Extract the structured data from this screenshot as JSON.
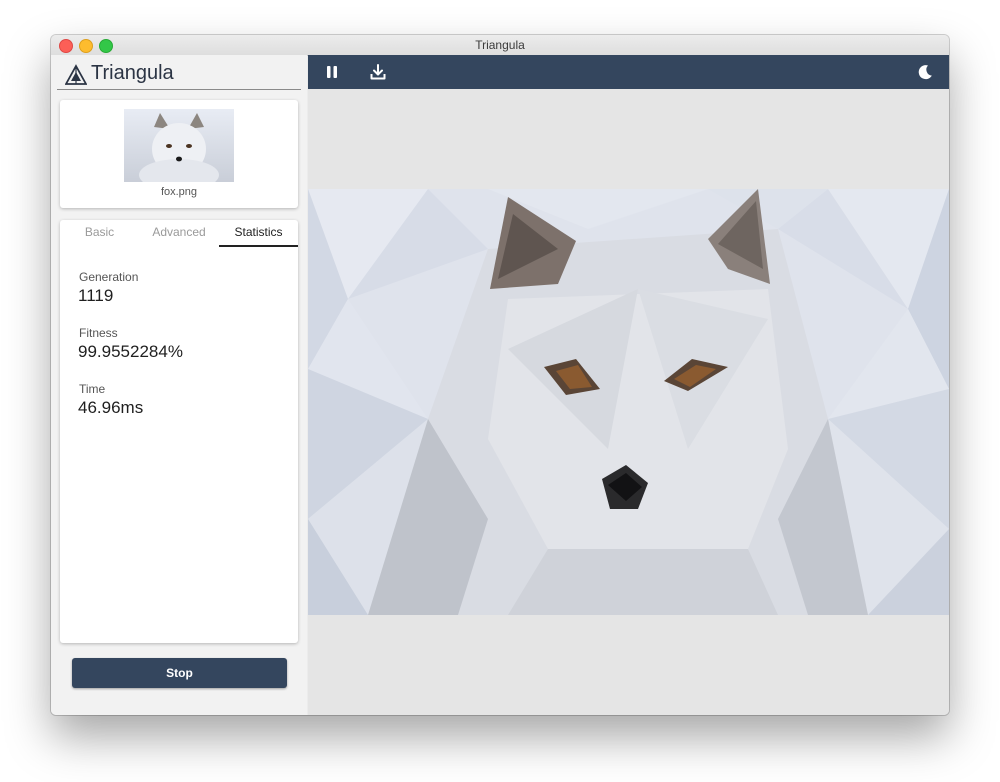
{
  "window": {
    "title": "Triangula"
  },
  "sidebar": {
    "app_name": "Triangula",
    "image_file": "fox.png",
    "tabs": [
      {
        "label": "Basic",
        "active": false
      },
      {
        "label": "Advanced",
        "active": false
      },
      {
        "label": "Statistics",
        "active": true
      }
    ],
    "stats": [
      {
        "label": "Generation",
        "value": "1119"
      },
      {
        "label": "Fitness",
        "value": "99.9552284%"
      },
      {
        "label": "Time",
        "value": "46.96ms"
      }
    ],
    "stop_label": "Stop"
  },
  "toolbar": {
    "icons": [
      "pause-icon",
      "download-icon",
      "dark-mode-moon-icon"
    ]
  },
  "colors": {
    "toolbar_bg": "#34465e",
    "button_bg": "#34465e",
    "brand_text": "#2b3444",
    "canvas_bg": "#e5e5e5"
  }
}
